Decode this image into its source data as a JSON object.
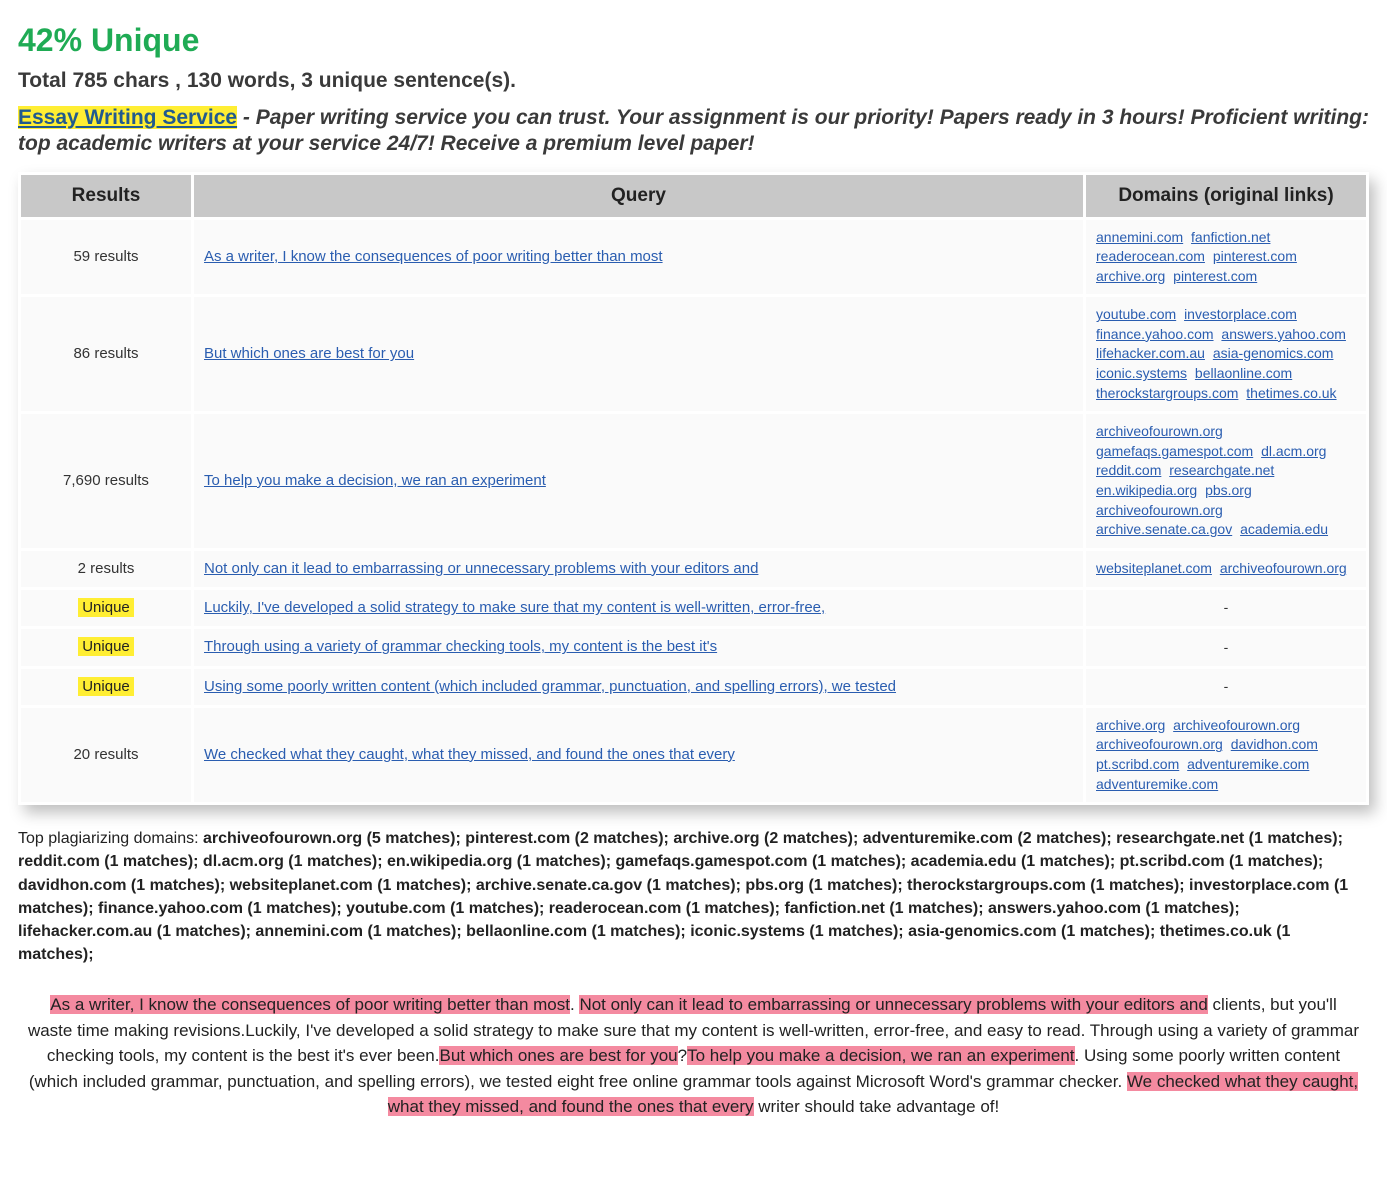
{
  "heading": "42% Unique",
  "stats": "Total 785 chars , 130 words, 3 unique sentence(s).",
  "promo_link": "Essay Writing Service",
  "promo_sep": " - ",
  "promo_rest": "Paper writing service you can trust. Your assignment is our priority! Papers ready in 3 hours! Proficient writing: top academic writers at your service 24/7! Receive a premium level paper!",
  "table": {
    "headers": {
      "results": "Results",
      "query": "Query",
      "domains": "Domains (original links)"
    },
    "rows": [
      {
        "results": "59 results",
        "unique": false,
        "query": "As a writer, I know the consequences of poor writing better than most",
        "domains": [
          "annemini.com",
          "fanfiction.net",
          "readerocean.com",
          "pinterest.com",
          "archive.org",
          "pinterest.com"
        ]
      },
      {
        "results": "86 results",
        "unique": false,
        "query": "But which ones are best for you",
        "domains": [
          "youtube.com",
          "investorplace.com",
          "finance.yahoo.com",
          "answers.yahoo.com",
          "lifehacker.com.au",
          "asia-genomics.com",
          "iconic.systems",
          "bellaonline.com",
          "therockstargroups.com",
          "thetimes.co.uk"
        ]
      },
      {
        "results": "7,690 results",
        "unique": false,
        "query": "To help you make a decision, we ran an experiment",
        "domains": [
          "archiveofourown.org",
          "gamefaqs.gamespot.com",
          "dl.acm.org",
          "reddit.com",
          "researchgate.net",
          "en.wikipedia.org",
          "pbs.org",
          "archiveofourown.org",
          "archive.senate.ca.gov",
          "academia.edu"
        ]
      },
      {
        "results": "2 results",
        "unique": false,
        "query": "Not only can it lead to embarrassing or unnecessary problems with your editors and",
        "domains": [
          "websiteplanet.com",
          "archiveofourown.org"
        ]
      },
      {
        "results": "Unique",
        "unique": true,
        "query": "Luckily, I've developed a solid strategy to make sure that my content is well-written, error-free,",
        "domains": []
      },
      {
        "results": "Unique",
        "unique": true,
        "query": "Through using a variety of grammar checking tools, my content is the best it's",
        "domains": []
      },
      {
        "results": "Unique",
        "unique": true,
        "query": "Using some poorly written content (which included grammar, punctuation, and spelling errors), we tested",
        "domains": []
      },
      {
        "results": "20 results",
        "unique": false,
        "query": "We checked what they caught, what they missed, and found the ones that every",
        "domains": [
          "archive.org",
          "archiveofourown.org",
          "archiveofourown.org",
          "davidhon.com",
          "pt.scribd.com",
          "adventuremike.com",
          "adventuremike.com"
        ]
      }
    ]
  },
  "top_domains_lead": "Top plagiarizing domains: ",
  "top_domains_body": "archiveofourown.org (5 matches); pinterest.com (2 matches); archive.org (2 matches); adventuremike.com (2 matches); researchgate.net (1 matches); reddit.com (1 matches); dl.acm.org (1 matches); en.wikipedia.org (1 matches); gamefaqs.gamespot.com (1 matches); academia.edu (1 matches); pt.scribd.com (1 matches); davidhon.com (1 matches); websiteplanet.com (1 matches); archive.senate.ca.gov (1 matches); pbs.org (1 matches); therockstargroups.com (1 matches); investorplace.com (1 matches); finance.yahoo.com (1 matches); youtube.com (1 matches); readerocean.com (1 matches); fanfiction.net (1 matches); answers.yahoo.com (1 matches); lifehacker.com.au (1 matches); annemini.com (1 matches); bellaonline.com (1 matches); iconic.systems (1 matches); asia-genomics.com (1 matches); thetimes.co.uk (1 matches);",
  "essay_segments": [
    {
      "t": "As a writer, I know the consequences of poor writing better than most",
      "hl": true
    },
    {
      "t": ". ",
      "hl": false
    },
    {
      "t": "Not only can it lead to embarrassing or unnecessary problems with your editors and",
      "hl": true
    },
    {
      "t": " clients, but you'll waste time making revisions.Luckily, I've developed a solid strategy to make sure that my content is well-written, error-free, and easy to read. Through using a variety of grammar checking tools, my content is the best it's ever been.",
      "hl": false
    },
    {
      "t": "But which ones are best for you",
      "hl": true
    },
    {
      "t": "?",
      "hl": false
    },
    {
      "t": "To help you make a decision, we ran an experiment",
      "hl": true
    },
    {
      "t": ". Using some poorly written content (which included grammar, punctuation, and spelling errors), we tested eight free online grammar tools against Microsoft Word's grammar checker. ",
      "hl": false
    },
    {
      "t": "We checked what they caught, what they missed, and found the ones that every",
      "hl": true
    },
    {
      "t": " writer should take advantage of!",
      "hl": false
    }
  ]
}
